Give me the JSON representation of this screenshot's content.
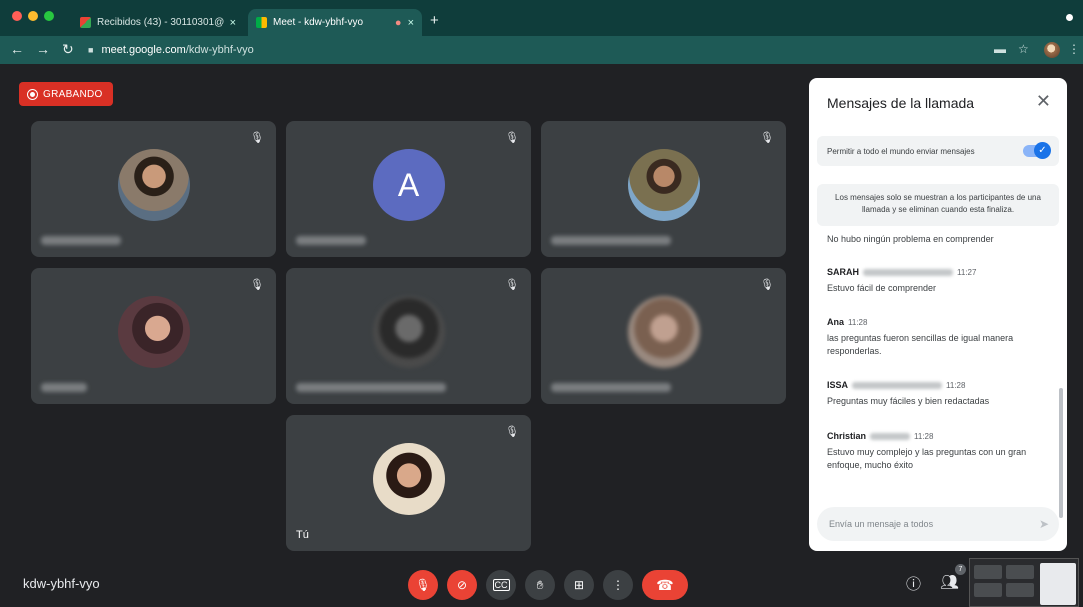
{
  "browser": {
    "tabs": [
      {
        "label": "Recibidos (43) - 30110301@u",
        "close": "×",
        "active": false
      },
      {
        "label": "Meet - kdw-ybhf-vyo",
        "close": "×",
        "active": true
      }
    ],
    "new_tab": "+",
    "url_host": "meet.google.com",
    "url_path": "/kdw-ybhf-vyo"
  },
  "recording": {
    "label": "GRABANDO"
  },
  "participants": [
    {
      "name": "",
      "avatar": "photo",
      "muted": true
    },
    {
      "name": "",
      "avatar": "letter",
      "letter": "A",
      "muted": true
    },
    {
      "name": "",
      "avatar": "photo",
      "muted": true
    },
    {
      "name": "",
      "avatar": "photo",
      "muted": true
    },
    {
      "name": "",
      "avatar": "photo",
      "muted": true
    },
    {
      "name": "",
      "avatar": "photo",
      "muted": true
    },
    {
      "name": "Tú",
      "avatar": "photo",
      "muted": true
    }
  ],
  "chat": {
    "title": "Mensajes de la llamada",
    "permission_label": "Permitir a todo el mundo enviar mensajes",
    "permission_enabled": true,
    "notice": "Los mensajes solo se muestran a los participantes de una llamada y se eliminan cuando esta finaliza.",
    "messages": [
      {
        "sender": "",
        "time": "",
        "text": "No hubo ningún problema en comprender"
      },
      {
        "sender": "SARAH",
        "time": "11:27",
        "text": "Estuvo fácil de comprender"
      },
      {
        "sender": "Ana",
        "time": "11:28",
        "text": "las preguntas fueron sencillas de igual manera responderlas."
      },
      {
        "sender": "ISSA",
        "time": "11:28",
        "text": "Preguntas muy fáciles y bien redactadas"
      },
      {
        "sender": "Christian",
        "time": "11:28",
        "text": "Estuvo muy complejo y las preguntas con un gran enfoque, mucho éxito"
      }
    ],
    "input_placeholder": "Envía un mensaje a todos"
  },
  "meeting": {
    "code": "kdw-ybhf-vyo",
    "participant_count": "7"
  },
  "colors": {
    "accent_red": "#ea4335",
    "chrome_teal": "#1e5a56",
    "tile_bg": "#3c4043"
  }
}
